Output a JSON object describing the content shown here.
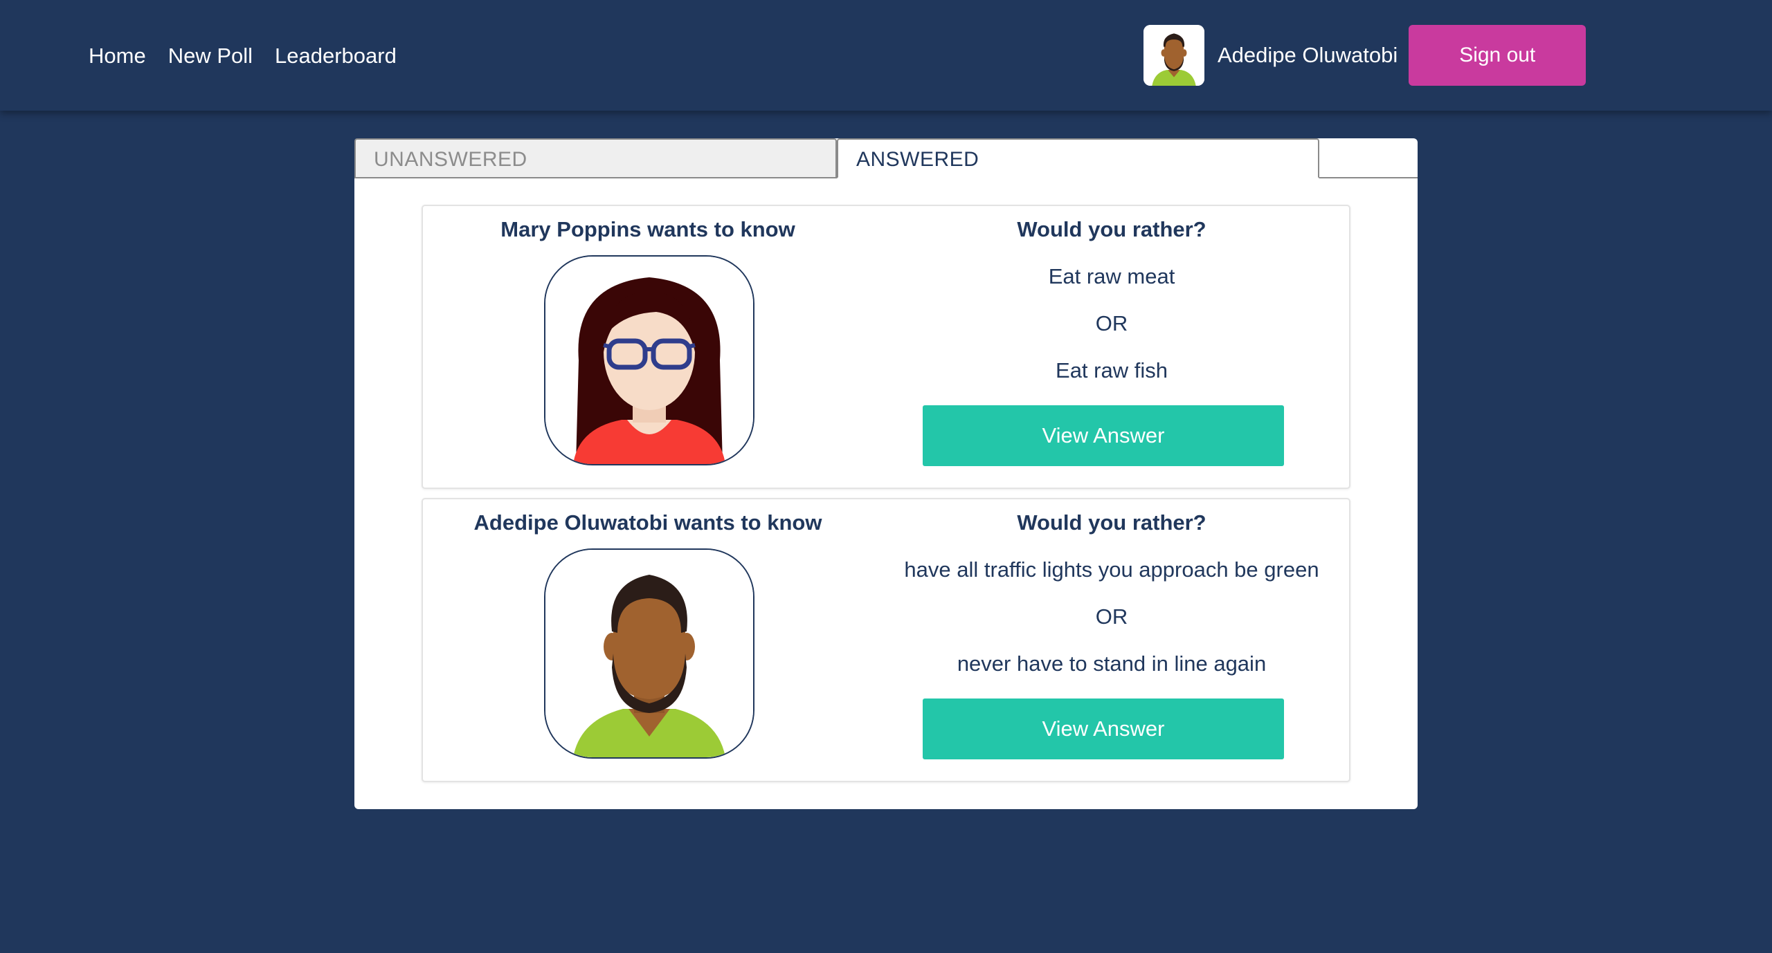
{
  "nav": {
    "links": [
      "Home",
      "New Poll",
      "Leaderboard"
    ],
    "user_name": "Adedipe Oluwatobi",
    "avatar_icon": "male-avatar-icon",
    "signout_label": "Sign out"
  },
  "tabs": {
    "unanswered_label": "UNANSWERED",
    "answered_label": "ANSWERED",
    "active": "ANSWERED"
  },
  "polls": [
    {
      "author_heading": "Mary Poppins wants to know",
      "avatar_icon": "female-avatar-icon",
      "question_title": "Would you rather?",
      "option_one": "Eat raw meat",
      "or_label": "OR",
      "option_two": "Eat raw fish",
      "button_label": "View Answer"
    },
    {
      "author_heading": "Adedipe Oluwatobi wants to know",
      "avatar_icon": "male-avatar-icon",
      "question_title": "Would you rather?",
      "option_one": "have all traffic lights you approach be green",
      "or_label": "OR",
      "option_two": "never have to stand in line again",
      "button_label": "View Answer"
    }
  ],
  "colors": {
    "background": "#20375c",
    "signout_button": "#c93a9e",
    "view_answer_button": "#23c6a9",
    "text_dark": "#20375c"
  }
}
